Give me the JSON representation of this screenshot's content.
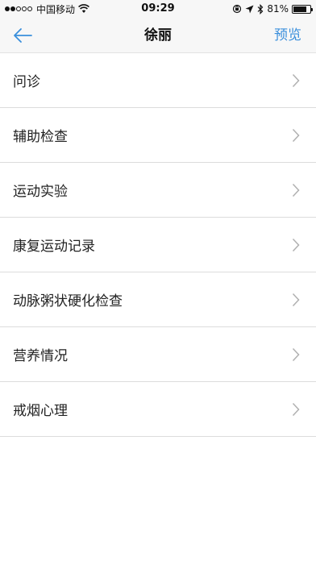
{
  "status_bar": {
    "carrier": "中国移动",
    "time": "09:29",
    "battery_percent_text": "81%",
    "battery_level": 0.81
  },
  "nav": {
    "title": "徐丽",
    "action_label": "预览",
    "accent_color": "#3a8fdc"
  },
  "menu": {
    "items": [
      {
        "label": "问诊"
      },
      {
        "label": "辅助检查"
      },
      {
        "label": "运动实验"
      },
      {
        "label": "康复运动记录"
      },
      {
        "label": "动脉粥状硬化检查"
      },
      {
        "label": "营养情况"
      },
      {
        "label": "戒烟心理"
      }
    ]
  }
}
